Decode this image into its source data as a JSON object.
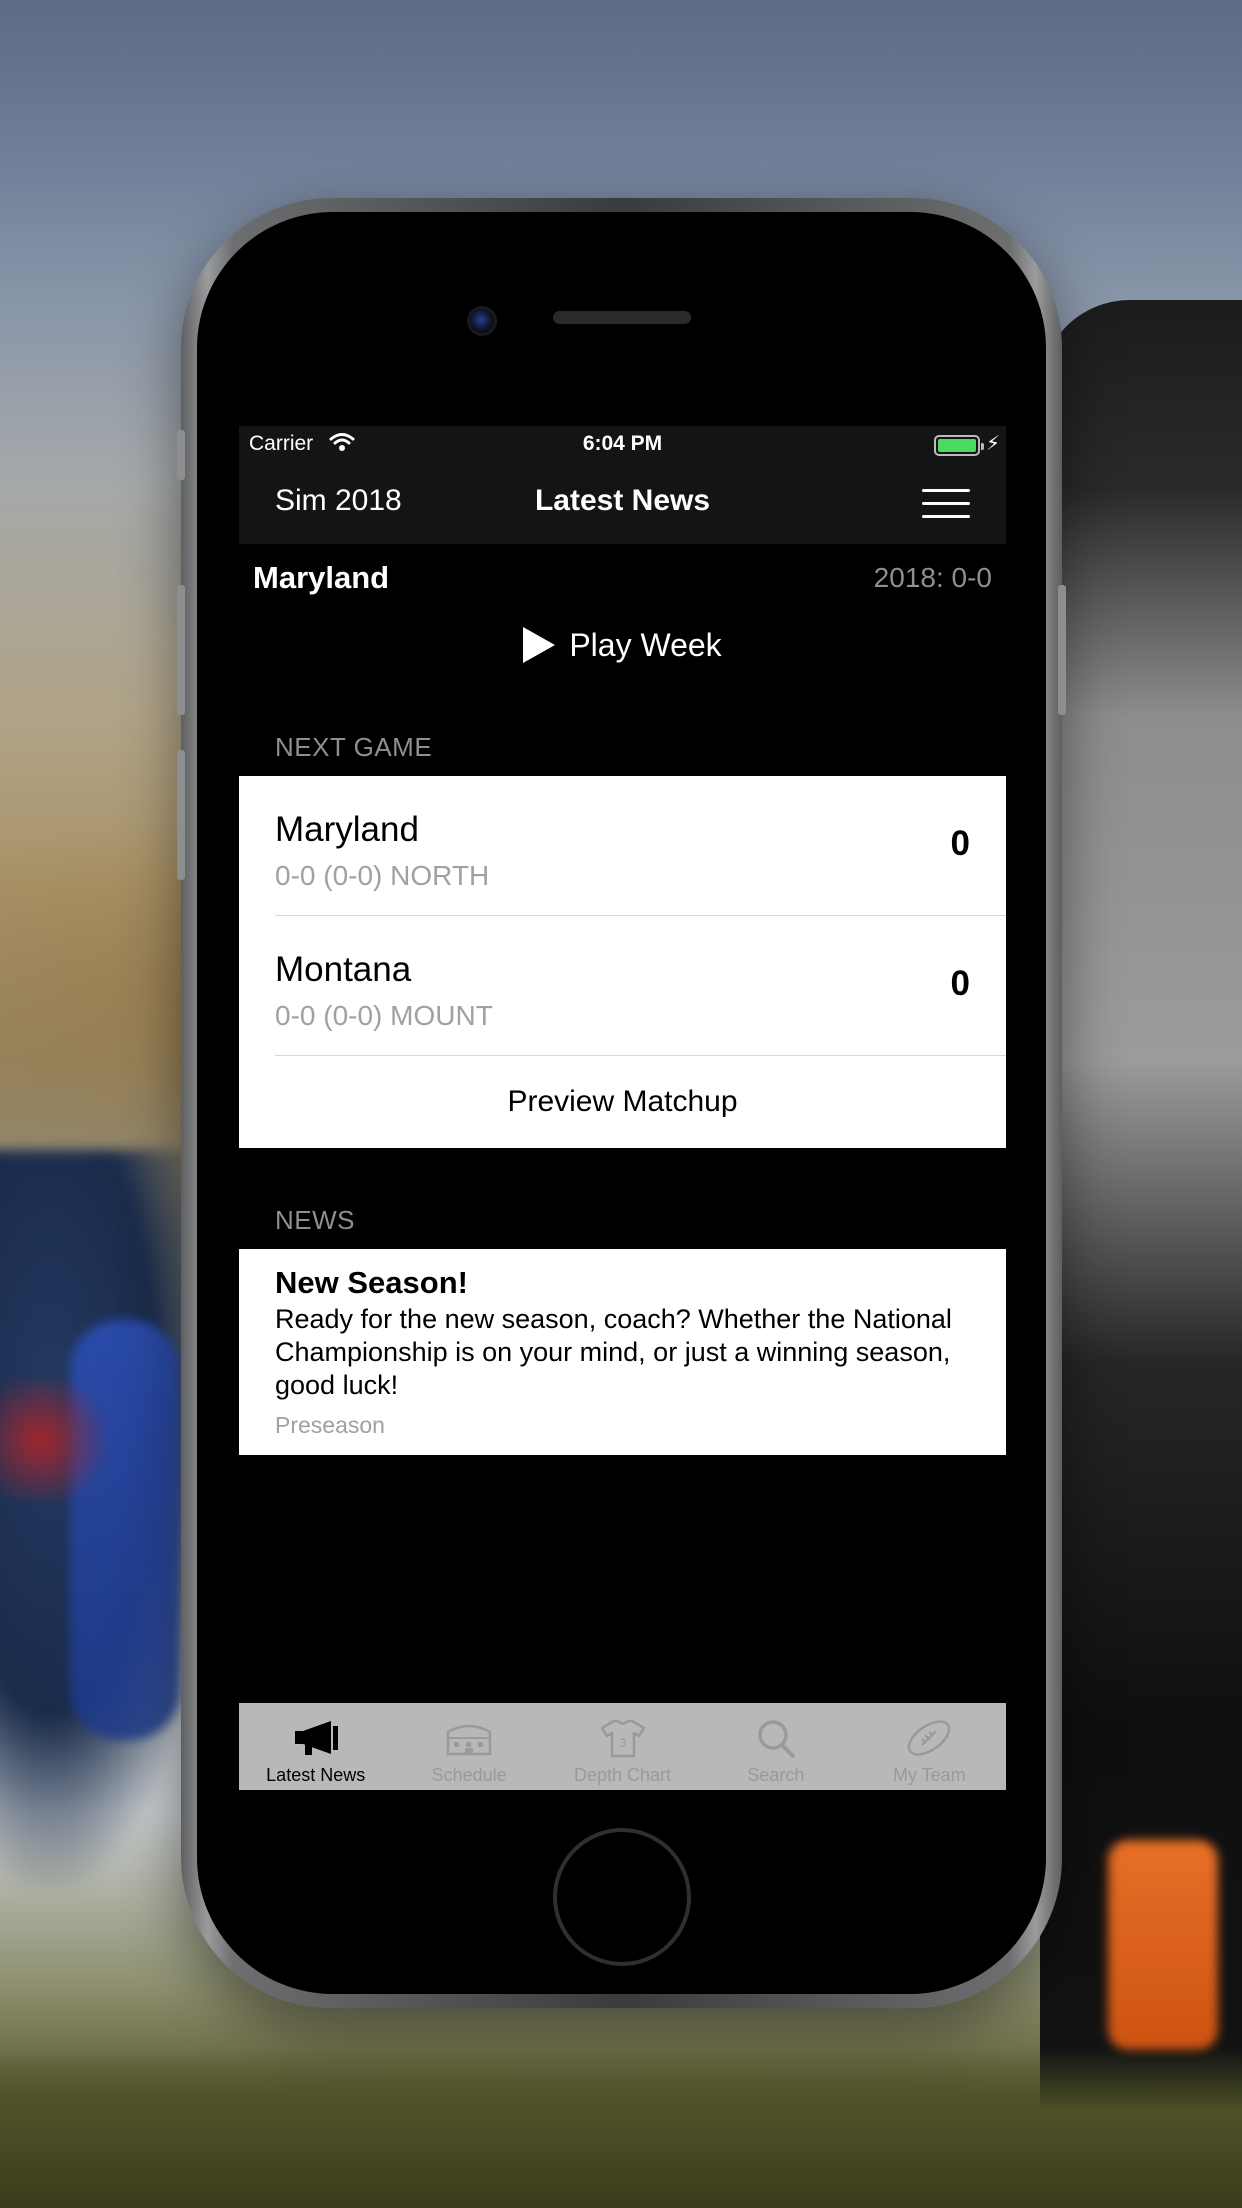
{
  "status_bar": {
    "carrier": "Carrier",
    "time": "6:04 PM",
    "battery_level": 1.0,
    "charging": true
  },
  "nav": {
    "left_label": "Sim 2018",
    "title": "Latest News",
    "menu_icon": "hamburger-menu-icon"
  },
  "team": {
    "name": "Maryland",
    "record": "2018: 0-0"
  },
  "play_week": {
    "label": "Play Week",
    "icon": "play-icon"
  },
  "next_game": {
    "header": "NEXT GAME",
    "home": {
      "name": "Maryland",
      "sub": "0-0 (0-0) NORTH",
      "score": "0"
    },
    "away": {
      "name": "Montana",
      "sub": "0-0 (0-0) MOUNT",
      "score": "0"
    },
    "preview_label": "Preview Matchup"
  },
  "news": {
    "header": "NEWS",
    "items": [
      {
        "title": "New Season!",
        "body": "Ready for the new season, coach? Whether the National Championship is on your mind, or just a winning season, good luck!",
        "meta": "Preseason"
      }
    ]
  },
  "tabs": [
    {
      "label": "Latest News",
      "icon": "megaphone-icon",
      "active": true
    },
    {
      "label": "Schedule",
      "icon": "stadium-icon",
      "active": false
    },
    {
      "label": "Depth Chart",
      "icon": "jersey-icon",
      "active": false
    },
    {
      "label": "Search",
      "icon": "search-icon",
      "active": false
    },
    {
      "label": "My Team",
      "icon": "football-icon",
      "active": false
    }
  ],
  "colors": {
    "accent_active": "#000000",
    "inactive": "#9a9a9a",
    "battery": "#4cd964",
    "bar_background": "#141414"
  }
}
